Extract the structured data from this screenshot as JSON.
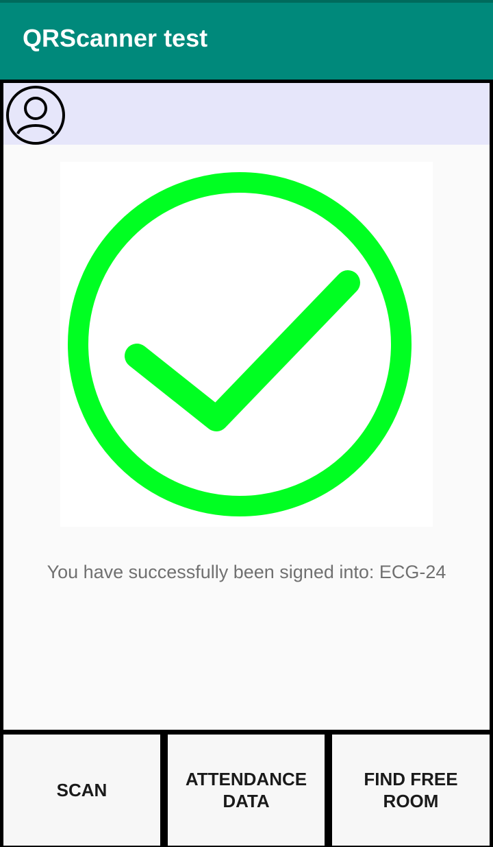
{
  "app": {
    "title": "QRScanner test",
    "colors": {
      "app_bar": "#00897b",
      "profile_bar": "#e6e6fa",
      "success": "#00ff22"
    }
  },
  "profile": {
    "icon": "user-avatar-icon"
  },
  "main": {
    "status_icon": "check-circle-icon",
    "message": "You have successfully been signed into: ECG-24"
  },
  "nav": {
    "scan_label": "SCAN",
    "attendance_label": "ATTENDANCE DATA",
    "find_room_label": "FIND FREE ROOM"
  }
}
